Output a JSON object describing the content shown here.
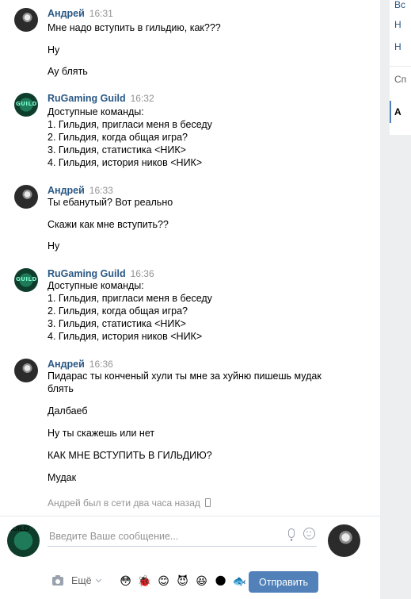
{
  "sidebar": {
    "items": [
      {
        "label": "Вс"
      },
      {
        "label": "Н"
      },
      {
        "label": "Н"
      },
      {
        "label": "Сп"
      },
      {
        "label": "А"
      }
    ]
  },
  "messages": [
    {
      "author": "Андрей",
      "time": "16:31",
      "lines": [
        "Мне надо вступить в гильдию, как???",
        "Ну",
        "Ау блять"
      ]
    },
    {
      "author": "RuGaming Guild",
      "time": "16:32",
      "lines": [
        "Доступные команды:",
        "1. Гильдия, пригласи меня в беседу",
        "2. Гильдия, когда общая игра?",
        "3. Гильдия, статистика <НИК>",
        "4. Гильдия, история ников <НИК>"
      ]
    },
    {
      "author": "Андрей",
      "time": "16:33",
      "lines": [
        "Ты ебанутый? Вот реально",
        "Скажи как мне вступить??",
        "Ну"
      ]
    },
    {
      "author": "RuGaming Guild",
      "time": "16:36",
      "lines": [
        "Доступные команды:",
        "1. Гильдия, пригласи меня в беседу",
        "2. Гильдия, когда общая игра?",
        "3. Гильдия, статистика <НИК>",
        "4. Гильдия, история ников <НИК>"
      ]
    },
    {
      "author": "Андрей",
      "time": "16:36",
      "lines": [
        "Пидарас ты конченый хули ты мне за хуйню пишешь мудак",
        "блять",
        "Далбаеб",
        "Ну ты скажешь или нет",
        "КАК МНЕ ВСТУПИТЬ В ГИЛЬДИЮ?",
        "Мудак"
      ]
    }
  ],
  "status_text": "Андрей был в сети два часа назад",
  "composer": {
    "placeholder": "Введите Ваше сообщение...",
    "more_label": "Ещё",
    "send_label": "Отправить",
    "emojis": [
      "😳",
      "🐞",
      "😊",
      "😈",
      "😆",
      "🌑",
      "🐟"
    ]
  },
  "colors": {
    "link": "#2a5885",
    "accent": "#5181b8",
    "muted": "#939393"
  }
}
